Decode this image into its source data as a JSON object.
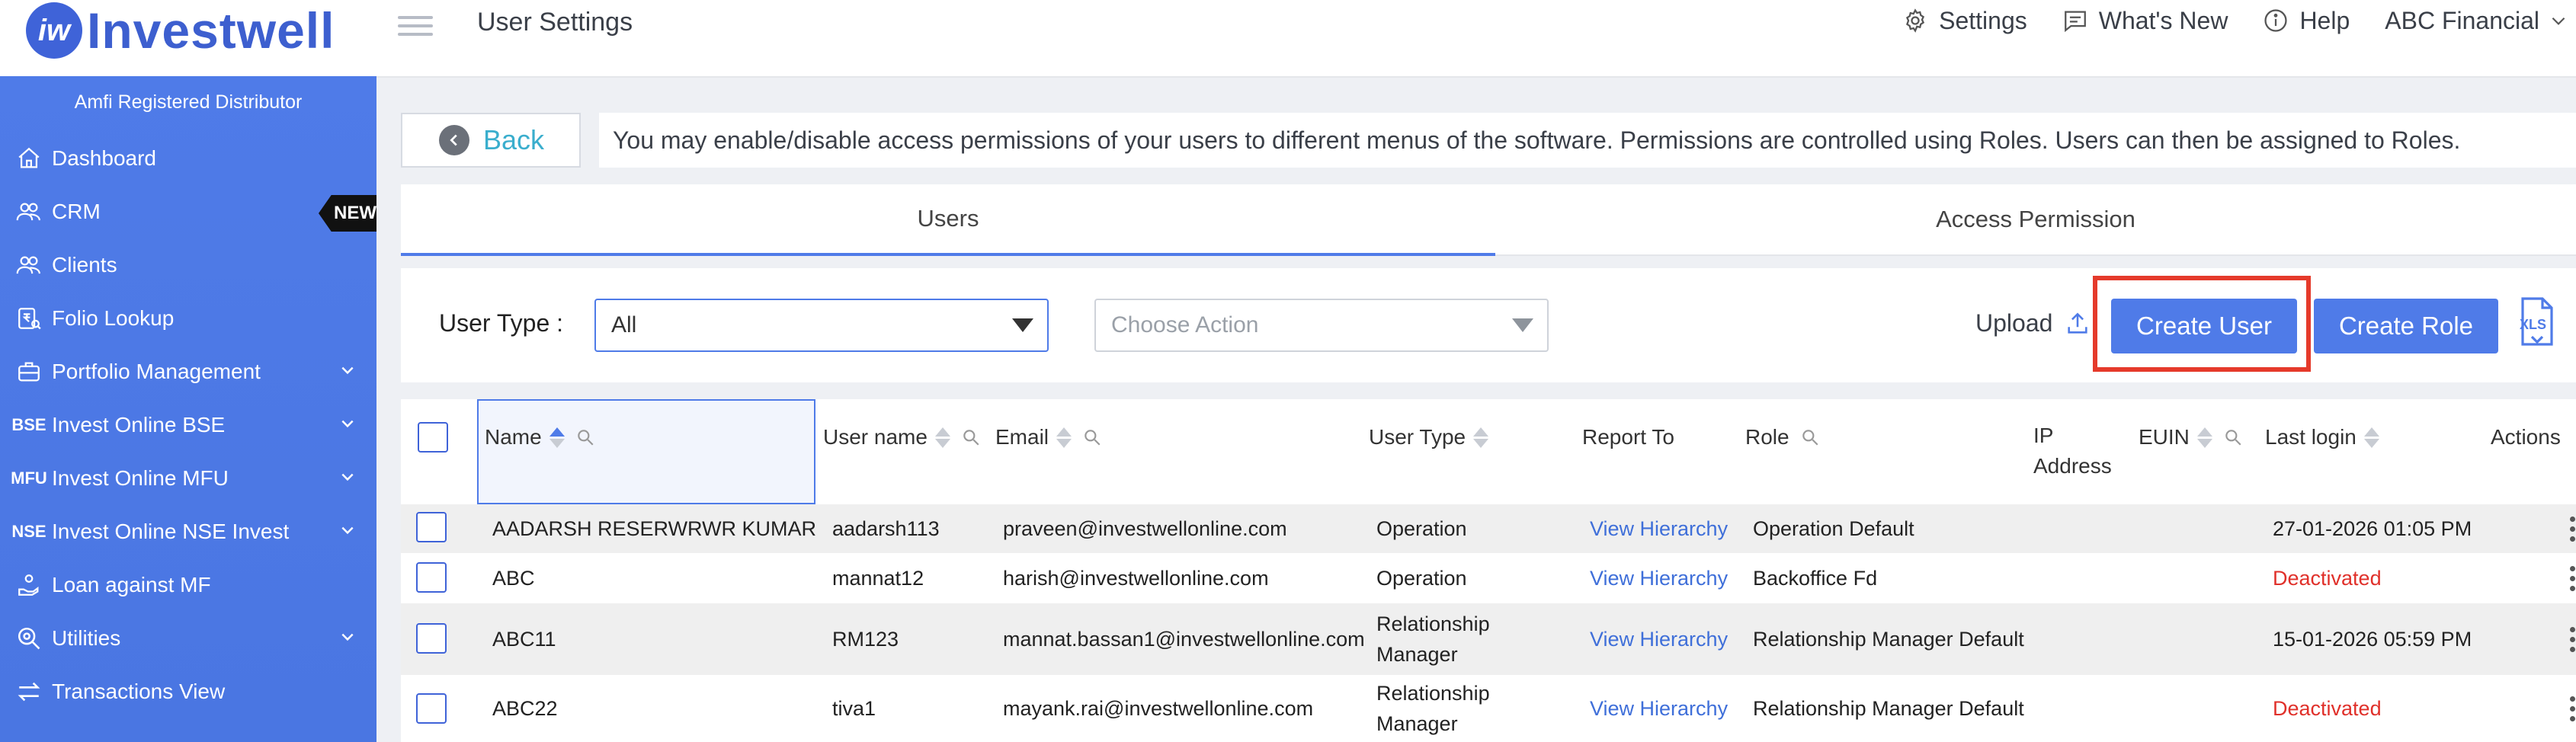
{
  "app": {
    "logo_text": "Investwell",
    "logo_mark": "iw",
    "page_title": "User Settings"
  },
  "top_nav": [
    {
      "label": "Settings",
      "icon": "gear-icon"
    },
    {
      "label": "What's New",
      "icon": "message-icon"
    },
    {
      "label": "Help",
      "icon": "info-icon"
    },
    {
      "label": "ABC Financial",
      "icon": "chevron-down-icon"
    }
  ],
  "sidebar": {
    "subtitle": "Amfi Registered Distributor",
    "new_badge": "NEW",
    "items": [
      {
        "label": "Dashboard",
        "icon": "home-icon"
      },
      {
        "label": "CRM",
        "icon": "people-icon"
      },
      {
        "label": "Clients",
        "icon": "people-icon"
      },
      {
        "label": "Folio Lookup",
        "icon": "rupee-search-icon"
      },
      {
        "label": "Portfolio Management",
        "icon": "briefcase-icon",
        "expandable": true
      },
      {
        "label": "Invest Online BSE",
        "icon_text": "BSE",
        "expandable": true
      },
      {
        "label": "Invest Online MFU",
        "icon_text": "MFU",
        "expandable": true
      },
      {
        "label": "Invest Online NSE Invest",
        "icon_text": "NSE",
        "expandable": true
      },
      {
        "label": "Loan against MF",
        "icon": "hand-coins-icon"
      },
      {
        "label": "Utilities",
        "icon": "gear-search-icon",
        "expandable": true
      },
      {
        "label": "Transactions View",
        "icon": "transfer-arrows-icon"
      }
    ]
  },
  "back_button": {
    "label": "Back"
  },
  "info_text": "You may enable/disable access permissions of your users to different menus of the software. Permissions are controlled using Roles. Users can then be assigned to Roles.",
  "tabs": [
    {
      "label": "Users",
      "active": true
    },
    {
      "label": "Access Permission",
      "active": false
    }
  ],
  "toolbar": {
    "user_type_label": "User Type :",
    "user_type_value": "All",
    "action_placeholder": "Choose Action",
    "upload_label": "Upload",
    "create_user_label": "Create User",
    "create_role_label": "Create Role",
    "xls_label": "XLS"
  },
  "colors": {
    "accent": "#4f7be8",
    "link": "#3f6fd9",
    "deactivated": "#e0302a",
    "highlight": "#e53a2b",
    "back_text": "#3aaecd"
  },
  "table": {
    "headers": {
      "name": "Name",
      "username": "User name",
      "email": "Email",
      "user_type": "User Type",
      "report_to": "Report To",
      "role": "Role",
      "ip_line1": "IP",
      "ip_line2": "Address",
      "euin": "EUIN",
      "last_login": "Last login",
      "actions": "Actions"
    },
    "rows": [
      {
        "name": "AADARSH RESERWRWR KUMAR",
        "username": "aadarsh113",
        "email": "praveen@investwellonline.com",
        "type_line1": "Operation",
        "type_line2": "",
        "report_to": "View Hierarchy",
        "role": "Operation Default",
        "last_login": "27-01-2026 01:05 PM",
        "deactivated": false
      },
      {
        "name": "ABC",
        "username": "mannat12",
        "email": "harish@investwellonline.com",
        "type_line1": "Operation",
        "type_line2": "",
        "report_to": "View Hierarchy",
        "role": "Backoffice Fd",
        "last_login": "Deactivated",
        "deactivated": true
      },
      {
        "name": "ABC11",
        "username": "RM123",
        "email": "mannat.bassan1@investwellonline.com",
        "type_line1": "Relationship",
        "type_line2": "Manager",
        "report_to": "View Hierarchy",
        "role": "Relationship Manager Default",
        "last_login": "15-01-2026 05:59 PM",
        "deactivated": false
      },
      {
        "name": "ABC22",
        "username": "tiva1",
        "email": "mayank.rai@investwellonline.com",
        "type_line1": "Relationship",
        "type_line2": "Manager",
        "report_to": "View Hierarchy",
        "role": "Relationship Manager Default",
        "last_login": "Deactivated",
        "deactivated": true
      }
    ]
  }
}
